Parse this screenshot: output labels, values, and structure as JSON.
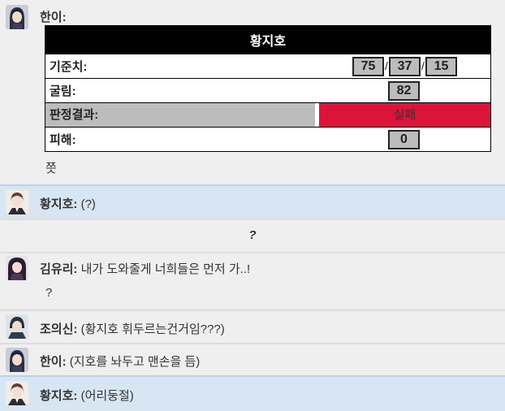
{
  "messages": {
    "m1": {
      "speaker": "한이:",
      "after_table": "쯧"
    },
    "judgement": {
      "title": "황지호",
      "rows": {
        "standard": {
          "label": "기준치:",
          "values": [
            "75",
            "37",
            "15"
          ]
        },
        "roll": {
          "label": "굴림:",
          "value": "82"
        },
        "result": {
          "label": "판정결과:",
          "value": "실패"
        },
        "damage": {
          "label": "피해:",
          "value": "0"
        }
      },
      "slash": "/"
    },
    "m2": {
      "speaker": "황지호:",
      "text": "(?)"
    },
    "m3": {
      "text": "?"
    },
    "m4": {
      "speaker": "김유리:",
      "text": "내가 도와줄게 너희들은 먼저 가..!",
      "extra": "?"
    },
    "m5": {
      "speaker": "조의신:",
      "text": "(황지호 휘두르는건거임???)"
    },
    "m6": {
      "speaker": "한이:",
      "text": "(지호를 놔두고 맨손을 듬)"
    },
    "m7": {
      "speaker": "황지호:",
      "text": "(어리둥절)"
    }
  },
  "colors": {
    "fail_red": "#dc143c",
    "header_black": "#000000",
    "gray_cell": "#bcbcbc",
    "highlight_blue": "#d8e5f2"
  }
}
